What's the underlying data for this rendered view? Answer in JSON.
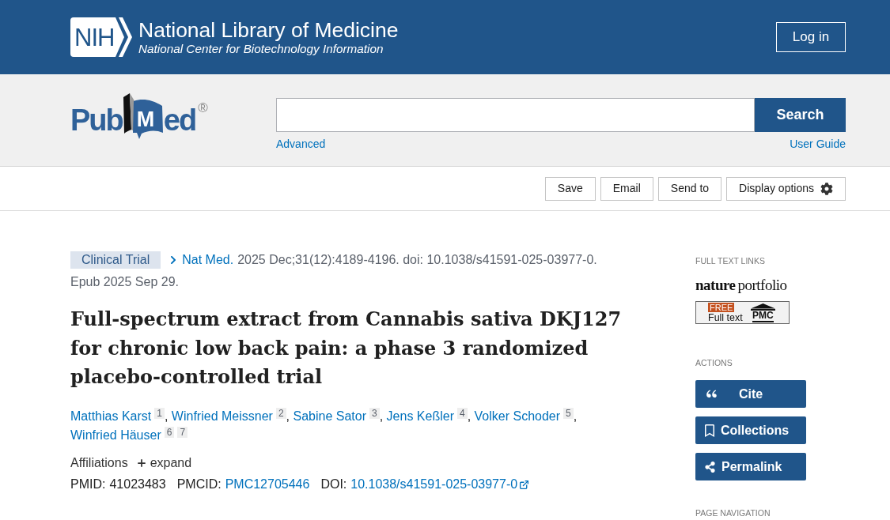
{
  "header": {
    "logo_text": "NIH",
    "title": "National Library of Medicine",
    "subtitle": "National Center for Biotechnology Information",
    "login_button": "Log in"
  },
  "search_bar": {
    "logo": {
      "before": "Pub",
      "book_letter": "M",
      "after": "ed",
      "mark": "®"
    },
    "button": "Search",
    "links": [
      "Advanced",
      "User Guide"
    ]
  },
  "toolbar": {
    "buttons": [
      {
        "label": "Save",
        "kind": "plain"
      },
      {
        "label": "Email",
        "kind": "plain"
      },
      {
        "label": "Send to",
        "kind": "plain"
      },
      {
        "label": "Display options",
        "kind": "settings"
      }
    ]
  },
  "article": {
    "publication_type": "Clinical Trial",
    "journal": "Nat Med.",
    "citation": "2025 Dec;31(12):4189-4196. doi: 10.1038/s41591-025-03977-0.",
    "epub": "Epub 2025 Sep 29.",
    "title": "Full-spectrum extract from Cannabis sativa DKJ127 for chronic low back pain: a phase 3 randomized placebo-controlled trial",
    "authors": [
      {
        "name": "Matthias Karst",
        "affiliations": [
          "1"
        ],
        "separator": ","
      },
      {
        "name": "Winfried Meissner",
        "affiliations": [
          "2"
        ],
        "separator": ","
      },
      {
        "name": "Sabine Sator",
        "affiliations": [
          "3"
        ],
        "separator": ","
      },
      {
        "name": "Jens Keßler",
        "affiliations": [
          "4"
        ],
        "separator": ","
      },
      {
        "name": "Volker Schoder",
        "affiliations": [
          "5"
        ],
        "separator": ","
      },
      {
        "name": "Winfried Häuser",
        "affiliations": [
          "6",
          "7"
        ]
      }
    ],
    "affiliations": {
      "label": "Affiliations",
      "toggle": "expand",
      "expanded": false
    },
    "identifiers": [
      {
        "label": "PMID:",
        "value": "41023483",
        "kind": "text"
      },
      {
        "label": "PMCID:",
        "value": "PMC12705446",
        "kind": "link"
      },
      {
        "label": "DOI:",
        "value": "10.1038/s41591-025-03977-0",
        "kind": "external_link"
      }
    ]
  },
  "sidebar": {
    "full_text_links": {
      "heading": "FULL TEXT LINKS",
      "publisher": {
        "bold": "nature",
        "regular": "portfolio"
      },
      "pmc_badge": {
        "free": "FREE",
        "label": "Full text",
        "source": "PMC"
      }
    },
    "actions": {
      "heading": "ACTIONS",
      "buttons": [
        {
          "label": "Cite",
          "kind": "cite"
        },
        {
          "label": "Collections",
          "kind": "collections"
        },
        {
          "label": "Permalink",
          "kind": "permalink"
        }
      ]
    },
    "page_navigation": {
      "heading": "PAGE NAVIGATION"
    }
  }
}
